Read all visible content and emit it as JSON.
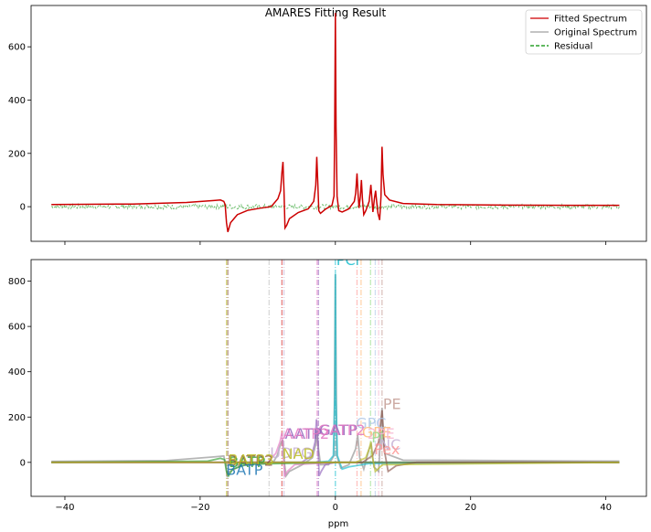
{
  "figure": {
    "title": "AMARES Fitting Result",
    "xlabel": "ppm"
  },
  "chart_data": [
    {
      "type": "line",
      "title": "AMARES Fitting Result",
      "xlim": [
        -45,
        46
      ],
      "ylim": [
        -130,
        755
      ],
      "x_ticks": [
        -40,
        -20,
        0,
        20,
        40
      ],
      "y_ticks": [
        0,
        200,
        400,
        600
      ],
      "legend": {
        "position": "top-right",
        "entries": [
          {
            "label": "Fitted Spectrum",
            "color": "#d62728",
            "dash": "solid"
          },
          {
            "label": "Original Spectrum",
            "color": "#b0b0b0",
            "dash": "solid"
          },
          {
            "label": "Residual",
            "color": "#2ca02c",
            "dash": "dashed"
          }
        ]
      },
      "series": [
        {
          "name": "Fitted Spectrum",
          "color": "#cc0000",
          "points": [
            [
              -42,
              8
            ],
            [
              -30,
              10
            ],
            [
              -22,
              16
            ],
            [
              -18,
              23
            ],
            [
              -17,
              25
            ],
            [
              -16.5,
              20
            ],
            [
              -16.3,
              8
            ],
            [
              -16.1,
              -60
            ],
            [
              -15.9,
              -95
            ],
            [
              -15.5,
              -60
            ],
            [
              -14.5,
              -30
            ],
            [
              -13,
              -14
            ],
            [
              -11,
              -5
            ],
            [
              -9.5,
              0
            ],
            [
              -9,
              15
            ],
            [
              -8.5,
              30
            ],
            [
              -8.1,
              60
            ],
            [
              -7.9,
              130
            ],
            [
              -7.75,
              168
            ],
            [
              -7.6,
              60
            ],
            [
              -7.45,
              -80
            ],
            [
              -7.2,
              -70
            ],
            [
              -6.8,
              -45
            ],
            [
              -5.5,
              -22
            ],
            [
              -4,
              -8
            ],
            [
              -3.2,
              20
            ],
            [
              -2.9,
              80
            ],
            [
              -2.75,
              187
            ],
            [
              -2.6,
              90
            ],
            [
              -2.45,
              -15
            ],
            [
              -2.2,
              -25
            ],
            [
              -1.5,
              -10
            ],
            [
              -0.5,
              5
            ],
            [
              -0.2,
              40
            ],
            [
              -0.1,
              300
            ],
            [
              0,
              727
            ],
            [
              0.1,
              300
            ],
            [
              0.25,
              40
            ],
            [
              0.5,
              -15
            ],
            [
              1,
              -20
            ],
            [
              2,
              -8
            ],
            [
              2.8,
              20
            ],
            [
              3,
              50
            ],
            [
              3.2,
              125
            ],
            [
              3.35,
              50
            ],
            [
              3.5,
              -5
            ],
            [
              3.7,
              40
            ],
            [
              3.85,
              100
            ],
            [
              4,
              30
            ],
            [
              4.2,
              -30
            ],
            [
              4.5,
              -15
            ],
            [
              5,
              20
            ],
            [
              5.1,
              45
            ],
            [
              5.25,
              82
            ],
            [
              5.4,
              30
            ],
            [
              5.55,
              -20
            ],
            [
              5.8,
              35
            ],
            [
              5.95,
              60
            ],
            [
              6.1,
              20
            ],
            [
              6.3,
              -25
            ],
            [
              6.55,
              -50
            ],
            [
              6.75,
              40
            ],
            [
              6.9,
              225
            ],
            [
              7.05,
              120
            ],
            [
              7.3,
              45
            ],
            [
              8,
              25
            ],
            [
              10,
              12
            ],
            [
              15,
              8
            ],
            [
              25,
              6
            ],
            [
              35,
              5
            ],
            [
              42,
              5
            ]
          ]
        },
        {
          "name": "Residual",
          "color": "#2ca02c",
          "x_range": [
            -42,
            42
          ],
          "amplitude": 9
        }
      ]
    },
    {
      "type": "line",
      "xlim": [
        -45,
        46
      ],
      "ylim": [
        -150,
        895
      ],
      "x_ticks": [
        -40,
        -20,
        0,
        20,
        40
      ],
      "y_ticks": [
        0,
        200,
        400,
        600,
        800
      ],
      "xlabel": "ppm",
      "vlines": [
        {
          "x": -16.1,
          "color": "#bcbd22"
        },
        {
          "x": -15.9,
          "color": "#8c564b"
        },
        {
          "x": -9.8,
          "color": "#bfbfbf"
        },
        {
          "x": -7.9,
          "color": "#d62728"
        },
        {
          "x": -7.6,
          "color": "#c5b0d5"
        },
        {
          "x": -2.7,
          "color": "#e377c2"
        },
        {
          "x": -2.5,
          "color": "#9467bd"
        },
        {
          "x": 0,
          "color": "#17becf"
        },
        {
          "x": 3.2,
          "color": "#ff9896"
        },
        {
          "x": 3.8,
          "color": "#ffbb78"
        },
        {
          "x": 5.2,
          "color": "#98df8a"
        },
        {
          "x": 5.9,
          "color": "#aec7e8"
        },
        {
          "x": 6.4,
          "color": "#f7b6d2"
        },
        {
          "x": 6.9,
          "color": "#c49c94"
        }
      ],
      "peaks": [
        {
          "name": "PCr",
          "x": 0,
          "height": 830,
          "label_y": 870,
          "color": "#17becf"
        },
        {
          "name": "PE",
          "x": 6.9,
          "height": 250,
          "label_y": 235,
          "color": "#c49c94"
        },
        {
          "name": "GPC",
          "x": 2.9,
          "height": 160,
          "label_y": 150,
          "color": "#aec7e8"
        },
        {
          "name": "GPE",
          "x": 3.8,
          "height": 110,
          "label_y": 110,
          "color": "#ffbb78"
        },
        {
          "name": "2PE",
          "x": 4.6,
          "height": 100,
          "label_y": 105,
          "color": "#f7b6d2"
        },
        {
          "name": "Pi",
          "x": 5.2,
          "height": 90,
          "label_y": 88,
          "color": "#98df8a"
        },
        {
          "name": "NC",
          "x": 6.4,
          "height": 60,
          "label_y": 55,
          "color": "#c5b0d5"
        },
        {
          "name": "Pex",
          "x": 5.6,
          "height": 40,
          "label_y": 35,
          "color": "#ff9896"
        },
        {
          "name": "GATP",
          "x": -2.5,
          "height": 190,
          "label_y": 120,
          "color": "#9467bd"
        },
        {
          "name": "GATP2",
          "x": -2.7,
          "height": 180,
          "label_y": 120,
          "color": "#e377c2"
        },
        {
          "name": "AATP",
          "x": -7.6,
          "height": 130,
          "label_y": 105,
          "color": "#9467bd"
        },
        {
          "name": "AATP2",
          "x": -7.9,
          "height": 120,
          "label_y": 105,
          "color": "#e377c2"
        },
        {
          "name": "UDPG",
          "x": -9.8,
          "height": 90,
          "label_y": 20,
          "color": "#c5b0d5"
        },
        {
          "name": "NAD",
          "x": -8.0,
          "height": 80,
          "label_y": 15,
          "color": "#bcbd22"
        },
        {
          "name": "BATP",
          "x": -15.9,
          "height": 70,
          "label_y": -20,
          "color": "#2ca02c"
        },
        {
          "name": "BATP2",
          "x": -16.1,
          "height": 70,
          "label_y": -15,
          "color": "#8c564b"
        },
        {
          "name": "BATP3",
          "x": -16.0,
          "height": 70,
          "label_y": -10,
          "color": "#bcbd22"
        },
        {
          "name": "BATP",
          "x": -16.3,
          "height": 70,
          "label_y": -55,
          "color": "#1f77b4"
        }
      ],
      "components": [
        {
          "name": "original",
          "color": "#8f8f8f",
          "points": [
            [
              -42,
              4
            ],
            [
              -25,
              8
            ],
            [
              -18,
              24
            ],
            [
              -16.5,
              28
            ],
            [
              -16.2,
              -10
            ],
            [
              -16,
              -60
            ],
            [
              -15.6,
              -40
            ],
            [
              -14,
              -15
            ],
            [
              -11,
              -5
            ],
            [
              -9.6,
              -5
            ],
            [
              -9.1,
              5
            ],
            [
              -8.6,
              30
            ],
            [
              -8.1,
              80
            ],
            [
              -7.8,
              100
            ],
            [
              -7.5,
              -10
            ],
            [
              -7.3,
              -60
            ],
            [
              -6.8,
              -40
            ],
            [
              -5,
              -12
            ],
            [
              -3.4,
              20
            ],
            [
              -2.9,
              80
            ],
            [
              -2.7,
              140
            ],
            [
              -2.5,
              60
            ],
            [
              -2.2,
              -10
            ],
            [
              -1,
              -10
            ],
            [
              -0.2,
              30
            ],
            [
              0,
              830
            ],
            [
              0.2,
              30
            ],
            [
              0.8,
              -25
            ],
            [
              2,
              -10
            ],
            [
              3,
              60
            ],
            [
              3.3,
              120
            ],
            [
              3.6,
              20
            ],
            [
              4.2,
              -30
            ],
            [
              5,
              60
            ],
            [
              5.3,
              80
            ],
            [
              5.7,
              -20
            ],
            [
              6.4,
              -40
            ],
            [
              6.9,
              240
            ],
            [
              7.3,
              40
            ],
            [
              10,
              10
            ],
            [
              42,
              5
            ]
          ]
        },
        {
          "name": "pcr",
          "color": "#17becf",
          "points": [
            [
              -42,
              0
            ],
            [
              -3,
              0
            ],
            [
              -1,
              5
            ],
            [
              -0.3,
              30
            ],
            [
              -0.08,
              300
            ],
            [
              0,
              830
            ],
            [
              0.08,
              300
            ],
            [
              0.3,
              30
            ],
            [
              1,
              -30
            ],
            [
              2,
              -20
            ],
            [
              5,
              -5
            ],
            [
              42,
              0
            ]
          ]
        },
        {
          "name": "atp",
          "color": "#9467bd",
          "points": [
            [
              -42,
              0
            ],
            [
              -5,
              0
            ],
            [
              -3.5,
              30
            ],
            [
              -3,
              90
            ],
            [
              -2.8,
              190
            ],
            [
              -2.6,
              100
            ],
            [
              -2.4,
              -60
            ],
            [
              -2.1,
              -40
            ],
            [
              -1.5,
              -10
            ],
            [
              0,
              0
            ],
            [
              42,
              0
            ]
          ]
        },
        {
          "name": "aatp",
          "color": "#e377c2",
          "points": [
            [
              -42,
              0
            ],
            [
              -10,
              0
            ],
            [
              -8.8,
              40
            ],
            [
              -8.2,
              90
            ],
            [
              -7.9,
              130
            ],
            [
              -7.7,
              40
            ],
            [
              -7.5,
              -60
            ],
            [
              -7.1,
              -40
            ],
            [
              -6,
              -10
            ],
            [
              0,
              0
            ],
            [
              42,
              0
            ]
          ]
        },
        {
          "name": "batp",
          "color": "#2ca02c",
          "points": [
            [
              -42,
              0
            ],
            [
              -19,
              5
            ],
            [
              -17,
              18
            ],
            [
              -16.4,
              12
            ],
            [
              -16.1,
              -40
            ],
            [
              -15.8,
              -60
            ],
            [
              -15.2,
              -30
            ],
            [
              -13,
              -8
            ],
            [
              0,
              0
            ],
            [
              42,
              0
            ]
          ]
        },
        {
          "name": "pe",
          "color": "#8c564b",
          "points": [
            [
              -42,
              0
            ],
            [
              4,
              0
            ],
            [
              5.5,
              30
            ],
            [
              6.4,
              90
            ],
            [
              6.9,
              230
            ],
            [
              7.2,
              60
            ],
            [
              7.8,
              -40
            ],
            [
              9,
              -15
            ],
            [
              12,
              0
            ],
            [
              42,
              0
            ]
          ]
        },
        {
          "name": "pi",
          "color": "#bcbd22",
          "points": [
            [
              -42,
              0
            ],
            [
              3,
              0
            ],
            [
              4.5,
              20
            ],
            [
              5,
              60
            ],
            [
              5.25,
              90
            ],
            [
              5.5,
              20
            ],
            [
              5.9,
              -40
            ],
            [
              7,
              -10
            ],
            [
              42,
              0
            ]
          ]
        }
      ]
    }
  ]
}
